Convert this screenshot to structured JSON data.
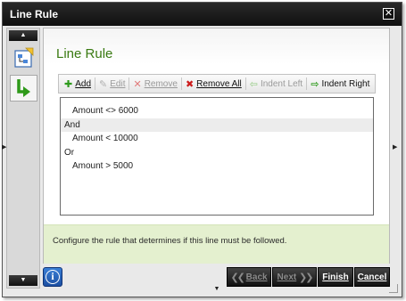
{
  "window": {
    "title": "Line Rule"
  },
  "heading": "Line Rule",
  "toolbar": {
    "add": "Add",
    "edit": "Edit",
    "remove": "Remove",
    "remove_all": "Remove All",
    "indent_left": "Indent Left",
    "indent_right": "Indent Right"
  },
  "rules": [
    {
      "text": "Amount <> 6000",
      "kind": "cond"
    },
    {
      "text": "And",
      "kind": "op"
    },
    {
      "text": "Amount < 10000",
      "kind": "cond"
    },
    {
      "text": "Or",
      "kind": "op"
    },
    {
      "text": "Amount > 5000",
      "kind": "cond"
    }
  ],
  "description": "Configure the rule that determines if this line must be followed.",
  "footer": {
    "back": "Back",
    "next": "Next",
    "finish": "Finish",
    "cancel": "Cancel"
  },
  "colors": {
    "heading": "#3a7a12",
    "desc_bg": "#e4f0cf",
    "titlebar": "#111111"
  }
}
